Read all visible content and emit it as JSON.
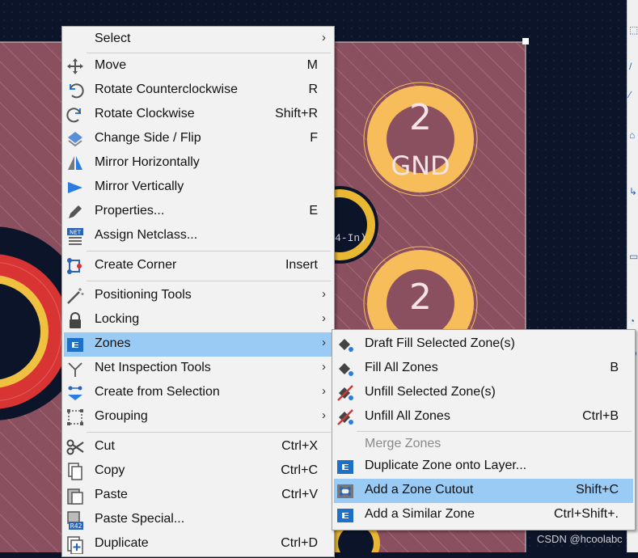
{
  "board": {
    "pads": [
      {
        "number": "2",
        "net": "GND"
      },
      {
        "number": "2",
        "net": ""
      }
    ],
    "partial_text": "4-In)"
  },
  "context_menu": {
    "items": [
      {
        "label": "Select",
        "shortcut": "",
        "icon": "select-icon",
        "submenu": true
      },
      {
        "label": "Move",
        "shortcut": "M",
        "icon": "move-icon"
      },
      {
        "label": "Rotate Counterclockwise",
        "shortcut": "R",
        "icon": "rotate-ccw-icon"
      },
      {
        "label": "Rotate Clockwise",
        "shortcut": "Shift+R",
        "icon": "rotate-cw-icon"
      },
      {
        "label": "Change Side / Flip",
        "shortcut": "F",
        "icon": "flip-icon"
      },
      {
        "label": "Mirror Horizontally",
        "shortcut": "",
        "icon": "mirror-h-icon"
      },
      {
        "label": "Mirror Vertically",
        "shortcut": "",
        "icon": "mirror-v-icon"
      },
      {
        "label": "Properties...",
        "shortcut": "E",
        "icon": "pencil-icon"
      },
      {
        "label": "Assign Netclass...",
        "shortcut": "",
        "icon": "netclass-icon"
      },
      {
        "label": "Create Corner",
        "shortcut": "Insert",
        "icon": "create-corner-icon"
      },
      {
        "label": "Positioning Tools",
        "shortcut": "",
        "icon": "positioning-wand-icon",
        "submenu": true
      },
      {
        "label": "Locking",
        "shortcut": "",
        "icon": "lock-icon",
        "submenu": true
      },
      {
        "label": "Zones",
        "shortcut": "",
        "icon": "zone-icon",
        "submenu": true,
        "highlighted": true
      },
      {
        "label": "Net Inspection Tools",
        "shortcut": "",
        "icon": "net-inspect-icon",
        "submenu": true
      },
      {
        "label": "Create from Selection",
        "shortcut": "",
        "icon": "create-from-selection-icon",
        "submenu": true
      },
      {
        "label": "Grouping",
        "shortcut": "",
        "icon": "group-icon",
        "submenu": true
      },
      {
        "label": "Cut",
        "shortcut": "Ctrl+X",
        "icon": "scissors-icon"
      },
      {
        "label": "Copy",
        "shortcut": "Ctrl+C",
        "icon": "copy-icon"
      },
      {
        "label": "Paste",
        "shortcut": "Ctrl+V",
        "icon": "paste-icon"
      },
      {
        "label": "Paste Special...",
        "shortcut": "",
        "icon": "paste-special-icon"
      },
      {
        "label": "Duplicate",
        "shortcut": "Ctrl+D",
        "icon": "duplicate-icon"
      }
    ]
  },
  "zones_submenu": {
    "items": [
      {
        "label": "Draft Fill Selected Zone(s)",
        "shortcut": "",
        "icon": "fill-bucket-icon"
      },
      {
        "label": "Fill All Zones",
        "shortcut": "B",
        "icon": "fill-bucket-icon"
      },
      {
        "label": "Unfill Selected Zone(s)",
        "shortcut": "",
        "icon": "unfill-icon"
      },
      {
        "label": "Unfill All Zones",
        "shortcut": "Ctrl+B",
        "icon": "unfill-icon"
      },
      {
        "label": "Merge Zones",
        "shortcut": "",
        "icon": "",
        "disabled": true
      },
      {
        "label": "Duplicate Zone onto Layer...",
        "shortcut": "",
        "icon": "zone-icon"
      },
      {
        "label": "Add a Zone Cutout",
        "shortcut": "Shift+C",
        "icon": "zone-cutout-icon",
        "highlighted": true
      },
      {
        "label": "Add a Similar Zone",
        "shortcut": "Ctrl+Shift+.",
        "icon": "zone-icon"
      }
    ]
  },
  "watermark": "CSDN @hcoolabc",
  "colors": {
    "background": "#0b1428",
    "zone_fill": "#8a5060",
    "pad": "#f7bd5a",
    "highlight": "#99cbf5",
    "red_copper": "#d83434"
  }
}
